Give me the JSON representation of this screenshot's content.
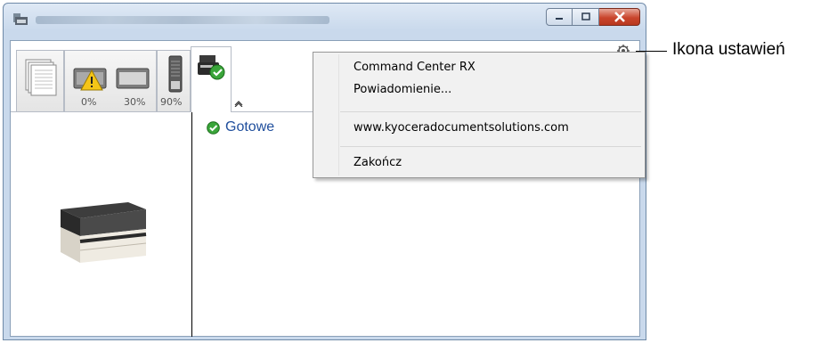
{
  "window": {
    "caption_buttons": [
      "minimize",
      "maximize",
      "close"
    ]
  },
  "tabs": {
    "supplies": [
      {
        "icon": "paper-stack-icon",
        "label": ""
      },
      {
        "icon": "toner-warning-icon",
        "label": "0%"
      },
      {
        "icon": "paper-tray-icon",
        "label": "30%"
      },
      {
        "icon": "waste-toner-icon",
        "label": "90%"
      }
    ],
    "active": {
      "icon": "printer-status-icon"
    }
  },
  "status": {
    "text": "Gotowe",
    "color": "#1f4e9c"
  },
  "menu": {
    "items": [
      {
        "label": "Command Center RX"
      },
      {
        "label": "Powiadomienie..."
      },
      {
        "label": "www.kyoceradocumentsolutions.com"
      },
      {
        "label": "Zakończ"
      }
    ]
  },
  "callout": {
    "label": "Ikona ustawień"
  },
  "colors": {
    "accent_close": "#c9452c",
    "status_ok": "#3aa53a",
    "warning": "#f5c518"
  }
}
